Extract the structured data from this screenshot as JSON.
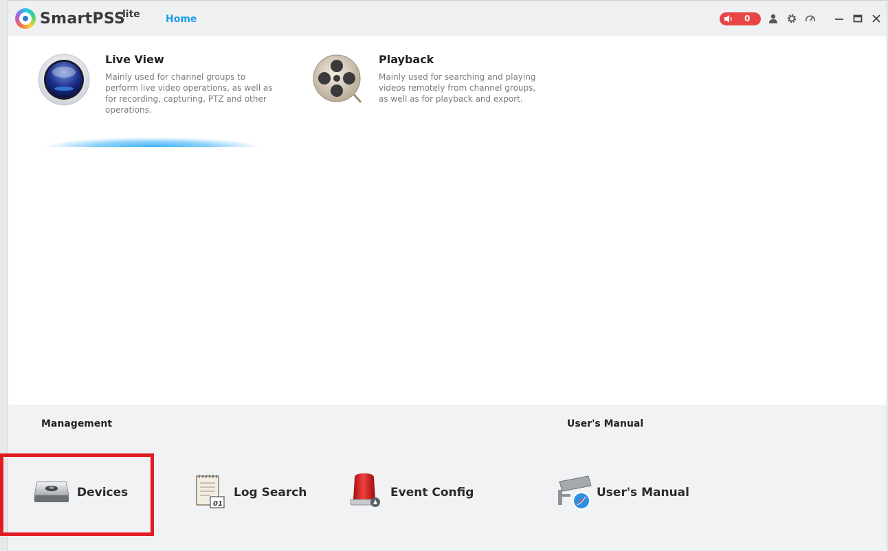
{
  "app": {
    "name": "SmartPSS",
    "edition": "lite"
  },
  "nav": {
    "home_tab": "Home"
  },
  "titlebar": {
    "alarm_count": "0",
    "icons": [
      "user-icon",
      "settings-icon",
      "performance-icon",
      "minimize-icon",
      "maximize-icon",
      "close-icon"
    ]
  },
  "features": [
    {
      "title": "Live View",
      "description": "Mainly used for channel groups to perform live video operations, as well as for recording, capturing, PTZ and other operations.",
      "icon": "live-view-icon"
    },
    {
      "title": "Playback",
      "description": "Mainly used for searching and playing videos remotely from channel groups, as well as for playback and export.",
      "icon": "film-reel-icon"
    }
  ],
  "management": {
    "title": "Management",
    "items": [
      {
        "label": "Devices",
        "icon": "device-icon"
      },
      {
        "label": "Log Search",
        "icon": "log-icon"
      },
      {
        "label": "Event Config",
        "icon": "alarm-light-icon"
      }
    ]
  },
  "manual": {
    "title": "User's Manual",
    "items": [
      {
        "label": "User's Manual",
        "icon": "manual-icon"
      }
    ]
  },
  "colors": {
    "accent": "#1aa0e6",
    "alarm": "#e84545",
    "highlight": "#e11b22"
  }
}
